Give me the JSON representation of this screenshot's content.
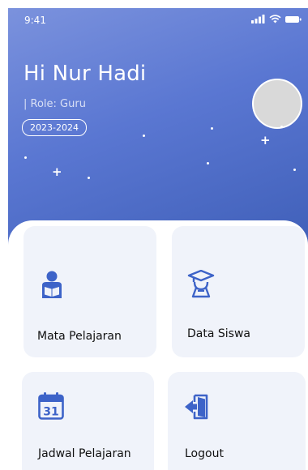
{
  "status_bar": {
    "time": "9:41",
    "icons": [
      "signal-icon",
      "wifi-icon",
      "battery-icon"
    ]
  },
  "header": {
    "greeting": "Hi Nur Hadi",
    "role": "| Role: Guru",
    "year": "2023-2024"
  },
  "menu": {
    "items": [
      {
        "label": "Mata Pelajaran",
        "icon": "student-reading-icon"
      },
      {
        "label": "Data Siswa",
        "icon": "graduate-icon"
      },
      {
        "label": "Jadwal Pelajaran",
        "icon": "calendar-icon"
      },
      {
        "label": "Logout",
        "icon": "logout-icon"
      }
    ],
    "calendar_day": "31"
  },
  "colors": {
    "header_gradient_start": "#7b92dd",
    "header_gradient_end": "#3f5fb8",
    "icon_color": "#3d63c8",
    "card_background": "#f0f3fa"
  }
}
